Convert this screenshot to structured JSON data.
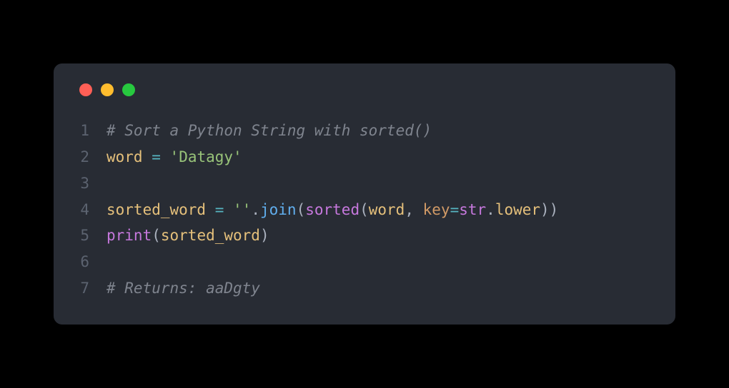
{
  "window": {
    "controls": [
      "close",
      "minimize",
      "maximize"
    ]
  },
  "code": {
    "lines": [
      {
        "num": "1",
        "tokens": [
          {
            "cls": "tok-comment",
            "text": "# Sort a Python String with sorted()"
          }
        ]
      },
      {
        "num": "2",
        "tokens": [
          {
            "cls": "tok-variable",
            "text": "word"
          },
          {
            "cls": "tok-default",
            "text": " "
          },
          {
            "cls": "tok-operator",
            "text": "="
          },
          {
            "cls": "tok-default",
            "text": " "
          },
          {
            "cls": "tok-string",
            "text": "'Datagy'"
          }
        ]
      },
      {
        "num": "3",
        "tokens": []
      },
      {
        "num": "4",
        "tokens": [
          {
            "cls": "tok-variable",
            "text": "sorted_word"
          },
          {
            "cls": "tok-default",
            "text": " "
          },
          {
            "cls": "tok-operator",
            "text": "="
          },
          {
            "cls": "tok-default",
            "text": " "
          },
          {
            "cls": "tok-string",
            "text": "''"
          },
          {
            "cls": "tok-default",
            "text": "."
          },
          {
            "cls": "tok-function",
            "text": "join"
          },
          {
            "cls": "tok-default",
            "text": "("
          },
          {
            "cls": "tok-builtin",
            "text": "sorted"
          },
          {
            "cls": "tok-default",
            "text": "("
          },
          {
            "cls": "tok-variable",
            "text": "word"
          },
          {
            "cls": "tok-default",
            "text": ", "
          },
          {
            "cls": "tok-param",
            "text": "key"
          },
          {
            "cls": "tok-operator",
            "text": "="
          },
          {
            "cls": "tok-builtin",
            "text": "str"
          },
          {
            "cls": "tok-default",
            "text": "."
          },
          {
            "cls": "tok-variable",
            "text": "lower"
          },
          {
            "cls": "tok-default",
            "text": "))"
          }
        ]
      },
      {
        "num": "5",
        "tokens": [
          {
            "cls": "tok-builtin",
            "text": "print"
          },
          {
            "cls": "tok-default",
            "text": "("
          },
          {
            "cls": "tok-variable",
            "text": "sorted_word"
          },
          {
            "cls": "tok-default",
            "text": ")"
          }
        ]
      },
      {
        "num": "6",
        "tokens": []
      },
      {
        "num": "7",
        "tokens": [
          {
            "cls": "tok-comment",
            "text": "# Returns: aaDgty"
          }
        ]
      }
    ]
  }
}
